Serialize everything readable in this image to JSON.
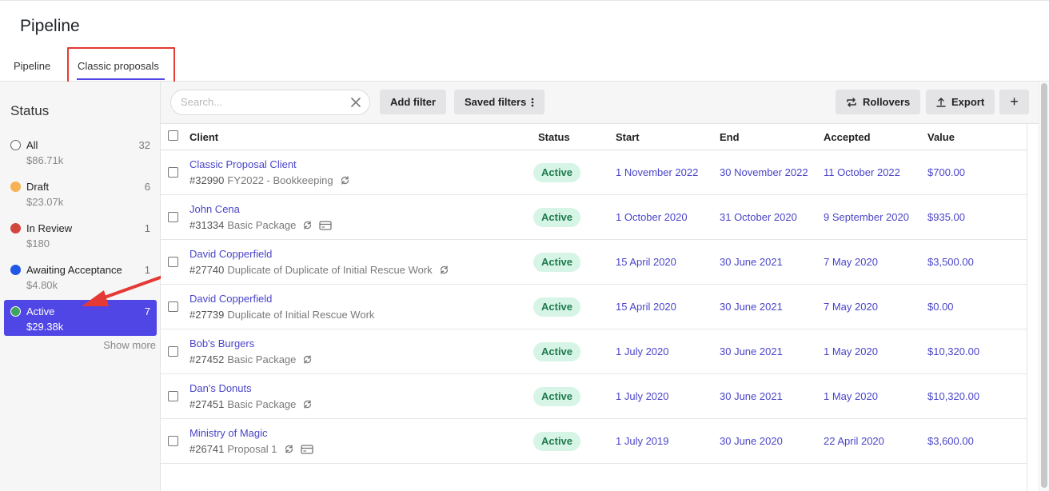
{
  "header": {
    "title": "Pipeline",
    "tabs": [
      {
        "label": "Pipeline"
      },
      {
        "label": "Classic proposals"
      }
    ]
  },
  "sidebar": {
    "title": "Status",
    "items": [
      {
        "label": "All",
        "count": "32",
        "amount": "$86.71k",
        "color": "#ffffff"
      },
      {
        "label": "Draft",
        "count": "6",
        "amount": "$23.07k",
        "color": "#f5b153"
      },
      {
        "label": "In Review",
        "count": "1",
        "amount": "$180",
        "color": "#d2473c"
      },
      {
        "label": "Awaiting Acceptance",
        "count": "1",
        "amount": "$4.80k",
        "color": "#2157e6"
      },
      {
        "label": "Active",
        "count": "7",
        "amount": "$29.38k",
        "color": "#3fa45f"
      }
    ],
    "show_more": "Show more"
  },
  "toolbar": {
    "search_placeholder": "Search...",
    "add_filter": "Add filter",
    "saved_filters": "Saved filters",
    "rollovers": "Rollovers",
    "export": "Export",
    "add": "+"
  },
  "table": {
    "columns": [
      "Client",
      "Status",
      "Start",
      "End",
      "Accepted",
      "Value"
    ],
    "rows": [
      {
        "client": "Classic Proposal Client",
        "number": "#32990",
        "package": "FY2022 - Bookkeeping",
        "icons": [
          "recurring-icon"
        ],
        "status": "Active",
        "start": "1 November 2022",
        "end": "30 November 2022",
        "accepted": "11 October 2022",
        "value": "$700.00"
      },
      {
        "client": "John Cena",
        "number": "#31334",
        "package": "Basic Package",
        "icons": [
          "recurring-icon",
          "card-icon"
        ],
        "status": "Active",
        "start": "1 October 2020",
        "end": "31 October 2020",
        "accepted": "9 September 2020",
        "value": "$935.00"
      },
      {
        "client": "David Copperfield",
        "number": "#27740",
        "package": "Duplicate of Duplicate of Initial Rescue Work",
        "icons": [
          "recurring-icon"
        ],
        "status": "Active",
        "start": "15 April 2020",
        "end": "30 June 2021",
        "accepted": "7 May 2020",
        "value": "$3,500.00"
      },
      {
        "client": "David Copperfield",
        "number": "#27739",
        "package": "Duplicate of Initial Rescue Work",
        "icons": [],
        "status": "Active",
        "start": "15 April 2020",
        "end": "30 June 2021",
        "accepted": "7 May 2020",
        "value": "$0.00"
      },
      {
        "client": "Bob's Burgers",
        "number": "#27452",
        "package": "Basic Package",
        "icons": [
          "recurring-icon"
        ],
        "status": "Active",
        "start": "1 July 2020",
        "end": "30 June 2021",
        "accepted": "1 May 2020",
        "value": "$10,320.00"
      },
      {
        "client": "Dan's Donuts",
        "number": "#27451",
        "package": "Basic Package",
        "icons": [
          "recurring-icon"
        ],
        "status": "Active",
        "start": "1 July 2020",
        "end": "30 June 2021",
        "accepted": "1 May 2020",
        "value": "$10,320.00"
      },
      {
        "client": "Ministry of Magic",
        "number": "#26741",
        "package": "Proposal 1",
        "icons": [
          "recurring-icon",
          "card-icon"
        ],
        "status": "Active",
        "start": "1 July 2019",
        "end": "30 June 2020",
        "accepted": "22 April 2020",
        "value": "$3,600.00"
      }
    ]
  },
  "colors": {
    "accent": "#4f46e5",
    "link": "#4a45c9",
    "badge_bg": "#d6f5e6",
    "badge_text": "#1f7a4d",
    "annotation": "#e53935"
  }
}
